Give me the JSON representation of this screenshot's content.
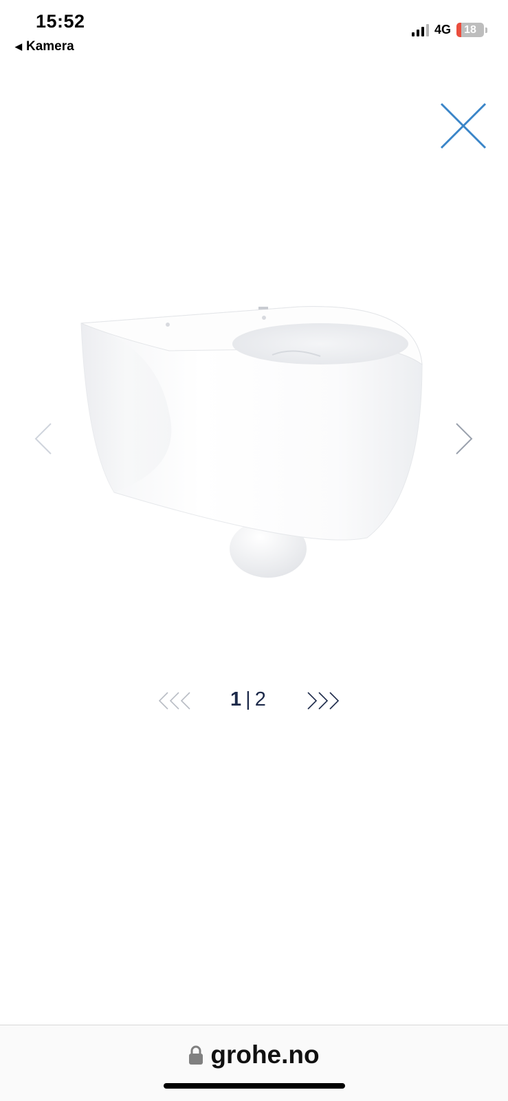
{
  "status_bar": {
    "time": "15:52",
    "back_label": "Kamera",
    "network": "4G",
    "battery_level": "18",
    "battery_fraction": 0.18
  },
  "icons": {
    "close": "close-icon",
    "prev": "chevron-left-icon",
    "next": "chevron-right-icon",
    "first": "triple-chevron-left-icon",
    "last": "triple-chevron-right-icon",
    "lock": "lock-icon"
  },
  "colors": {
    "close_icon": "#3a85c8",
    "pager_text": "#1d2a4a",
    "nav_arrow_inactive": "#cfd4dc",
    "nav_arrow_active": "#9aa1ad",
    "battery_low": "#eb4d3d"
  },
  "gallery": {
    "current_page": "1",
    "separator": "|",
    "total_pages": "2"
  },
  "browser": {
    "url": "grohe.no"
  }
}
